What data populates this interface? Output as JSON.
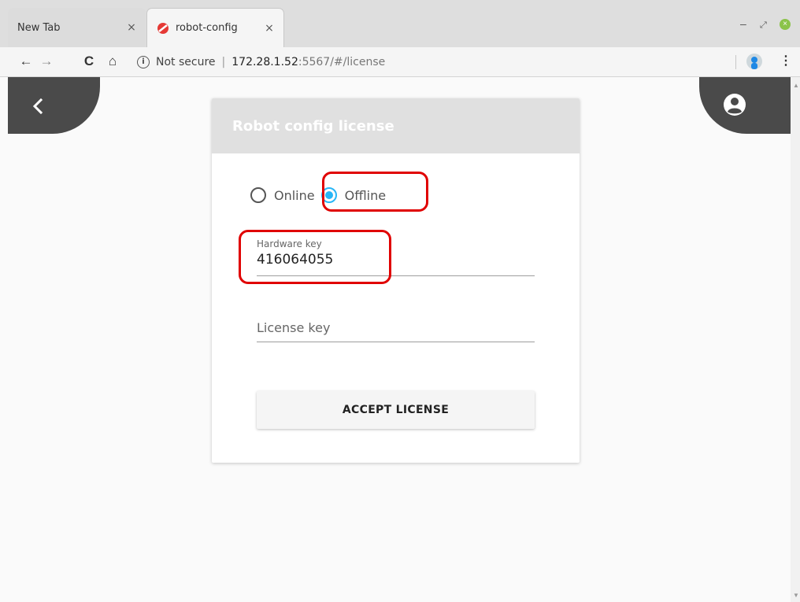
{
  "browser": {
    "tabs": [
      {
        "title": "New Tab",
        "close": "×"
      },
      {
        "title": "robot-config",
        "close": "×"
      }
    ],
    "address": {
      "security_label": "Not secure",
      "separator": "|",
      "host": "172.28.1.52",
      "rest": ":5567/#/license"
    },
    "window_controls": {
      "minimize": "–",
      "maximize": "⤢",
      "close": "×"
    },
    "nav": {
      "back": "←",
      "forward": "→",
      "reload": "C",
      "home": "⌂",
      "menu": "⋮"
    }
  },
  "page": {
    "card": {
      "title": "Robot config license",
      "mode": {
        "options": [
          {
            "label": "Online",
            "checked": false
          },
          {
            "label": "Offline",
            "checked": true
          }
        ]
      },
      "hardware_key": {
        "label": "Hardware key",
        "value": "416064055"
      },
      "license_key": {
        "placeholder": "License key",
        "value": ""
      },
      "accept_label": "ACCEPT LICENSE"
    }
  },
  "colors": {
    "accent": "#29b6f6",
    "fab": "#4a4a4a",
    "highlight": "#e00000",
    "header": "#e0e0e0"
  }
}
